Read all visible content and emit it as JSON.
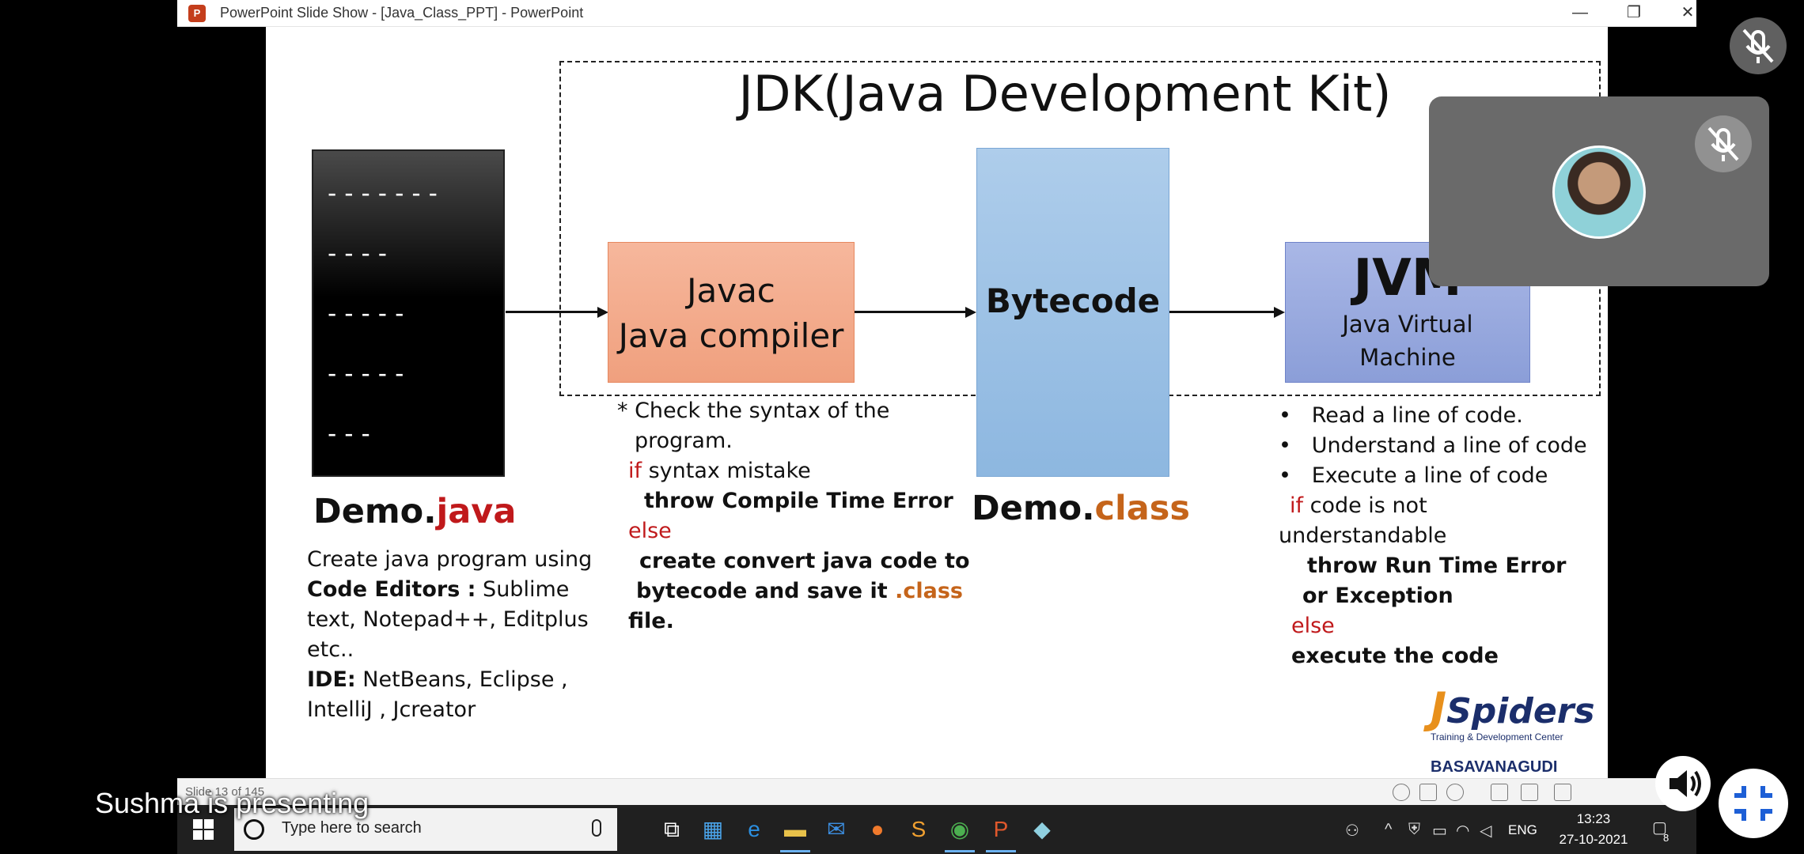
{
  "window": {
    "app_title": "PowerPoint Slide Show - [Java_Class_PPT] - PowerPoint",
    "minimize": "—",
    "restore": "❐",
    "close": "✕"
  },
  "slide": {
    "jdk_title": "JDK(Java Development Kit)",
    "source_dashes": [
      "-------",
      "----",
      "-----",
      "-----",
      "---"
    ],
    "javac_line1": "Javac",
    "javac_line2": "Java compiler",
    "bytecode_label": "Bytecode",
    "jvm_big": "JVM",
    "jvm_line1": "Java Virtual",
    "jvm_line2": "Machine",
    "demo_java_prefix": "Demo.",
    "demo_java_ext": "java",
    "demo_class_prefix": "Demo.",
    "demo_class_ext": "class",
    "left_text": {
      "l1": "Create java program using",
      "l2_bold": "Code Editors :",
      "l2_rest": " Sublime",
      "l3": "text, Notepad++, Editplus",
      "l4": "etc..",
      "l5_bold": "IDE:",
      "l5_rest": " NetBeans, Eclipse ,",
      "l6": "IntelliJ , Jcreator"
    },
    "javac_text": {
      "l1": "* Check the syntax of the",
      "l2": "program.",
      "l3_kw": "if",
      "l3_rest": " syntax mistake",
      "l4": "throw Compile Time Error",
      "l5_kw": "else",
      "l6": "create convert java code to",
      "l7_a": "bytecode and save it ",
      "l7_b": ".class",
      "l8": "file."
    },
    "jvm_text": {
      "b1": "Read a line of code.",
      "b2": "Understand a line of code",
      "b3": "Execute a line of code",
      "l4_kw": "if",
      "l4_rest": " code is not",
      "l5": "understandable",
      "l6": "throw Run Time Error",
      "l7": "or Exception",
      "l8_kw": "else",
      "l9": "execute the code"
    },
    "logo": {
      "j": "J",
      "name": "Spiders",
      "tagline": "Training & Development Center",
      "location": "BASAVANAGUDI"
    }
  },
  "status_bar": {
    "slide_counter": "Slide 13 of 145"
  },
  "meeting": {
    "presenting_text": "Sushma is presenting"
  },
  "taskbar": {
    "search_placeholder": "Type here to search",
    "lang": "ENG",
    "time": "13:23",
    "date": "27-10-2021",
    "notification_count": "8"
  }
}
